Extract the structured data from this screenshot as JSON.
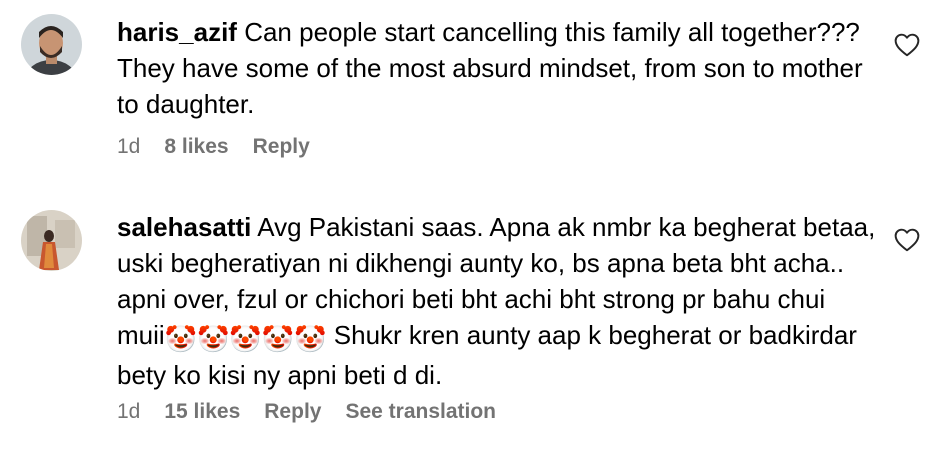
{
  "comments": [
    {
      "username": "haris_azif",
      "text": "Can people start cancelling this family all together??? They have some of the most absurd mindset, from son to mother to daughter.",
      "time": "1d",
      "likes": "8 likes",
      "reply": "Reply"
    },
    {
      "username": "salehasatti",
      "text_before": "Avg Pakistani saas. Apna ak nmbr ka begherat betaa, uski begheratiyan ni dikhengi aunty ko, bs apna beta bht acha.. apni over, fzul or chichori beti bht achi bht strong pr bahu chui muii",
      "emoji": "🤡🤡🤡🤡🤡",
      "text_after": " Shukr kren aunty aap k begherat or badkirdar bety ko kisi ny apni beti d di.",
      "time": "1d",
      "likes": "15 likes",
      "reply": "Reply",
      "translate": "See translation"
    }
  ],
  "icons": {
    "like": "heart-outline-icon",
    "emoji": "clown-face-emoji"
  },
  "colors": {
    "text": "#000000",
    "meta": "#737373"
  }
}
